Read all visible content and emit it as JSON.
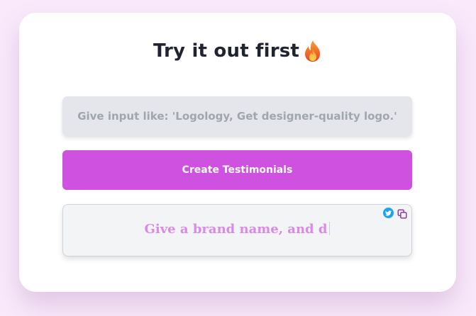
{
  "card": {
    "title": "Try it out first",
    "title_icon": "fire-icon"
  },
  "input": {
    "value": "",
    "placeholder": "Give input like: 'Logology, Get designer-quality logo.'"
  },
  "create_button": {
    "label": "Create Testimonials",
    "color": "#cf51e0"
  },
  "output": {
    "text": "Give a brand name, and d",
    "text_color": "#d98ae6",
    "share_icon": "twitter-icon",
    "copy_icon": "copy-icon"
  }
}
